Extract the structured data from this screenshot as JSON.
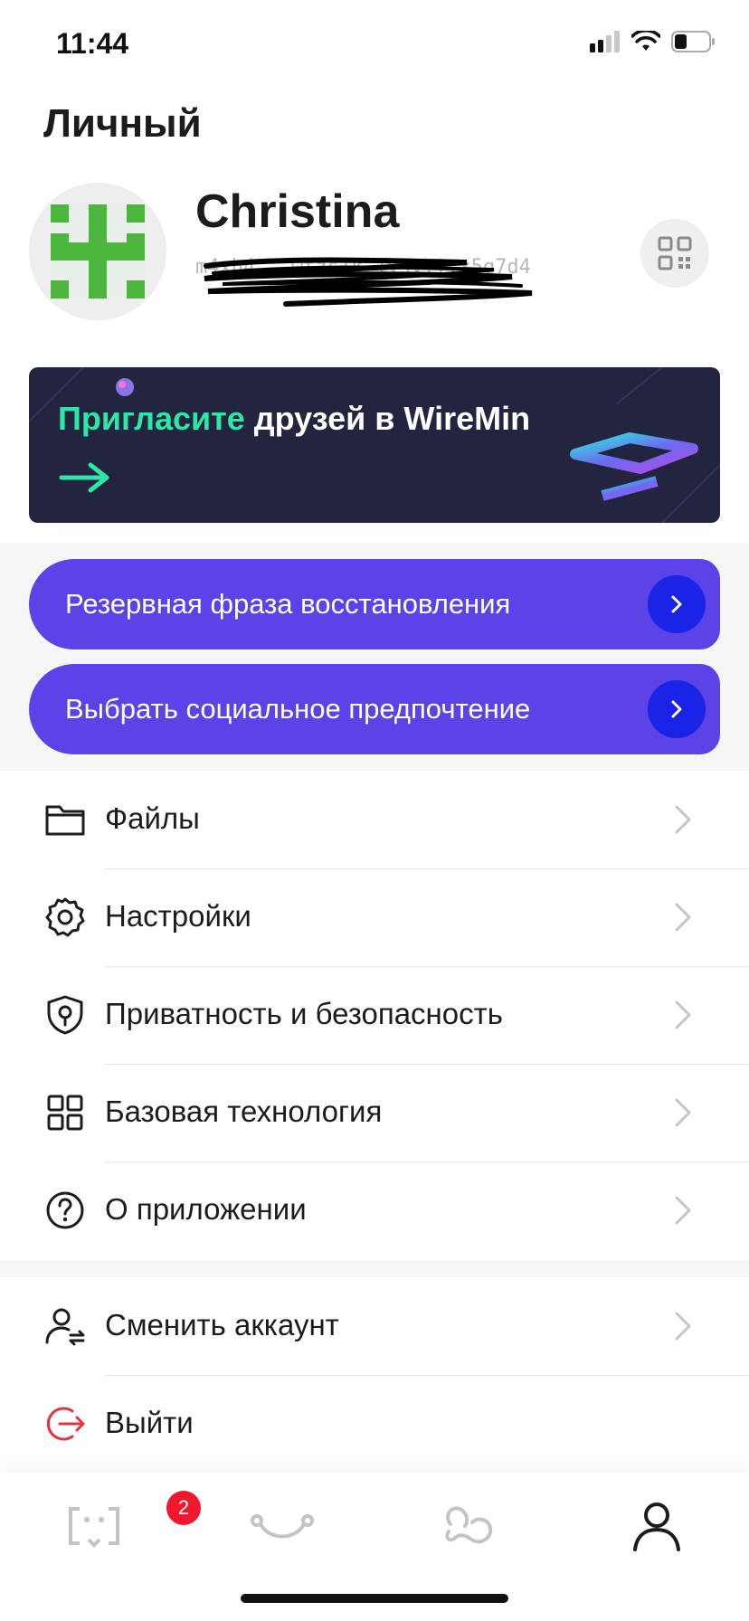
{
  "status_bar": {
    "time": "11:44"
  },
  "page": {
    "title": "Личный"
  },
  "profile": {
    "name": "Christina",
    "address": "m4xh4...wtzs1k 1ysv...x5q7d4"
  },
  "invite_banner": {
    "accent_text": "Пригласите",
    "text": " друзей в WireMin"
  },
  "actions": [
    {
      "label": "Резервная фраза восстановления"
    },
    {
      "label": "Выбрать социальное предпочтение"
    }
  ],
  "menu": {
    "items": [
      {
        "label": "Файлы",
        "icon": "folder-icon"
      },
      {
        "label": "Настройки",
        "icon": "gear-icon"
      },
      {
        "label": "Приватность и безопасность",
        "icon": "shield-icon"
      },
      {
        "label": "Базовая технология",
        "icon": "grid-icon"
      },
      {
        "label": "О приложении",
        "icon": "question-circle-icon"
      }
    ],
    "account_items": [
      {
        "label": "Сменить аккаунт",
        "icon": "switch-user-icon"
      },
      {
        "label": "Выйти",
        "icon": "logout-icon"
      }
    ]
  },
  "tab_bar": {
    "tabs": [
      {
        "icon": "chat-bracket-icon",
        "badge": "2"
      },
      {
        "icon": "connect-icon"
      },
      {
        "icon": "link-icon"
      },
      {
        "icon": "person-icon"
      }
    ]
  },
  "colors": {
    "accent": "#5b43e8",
    "chevron": "#1a23e6",
    "invite_accent": "#2ee6a6",
    "banner_bg": "#232440",
    "logout": "#e0343f",
    "badge": "#f2172a"
  }
}
